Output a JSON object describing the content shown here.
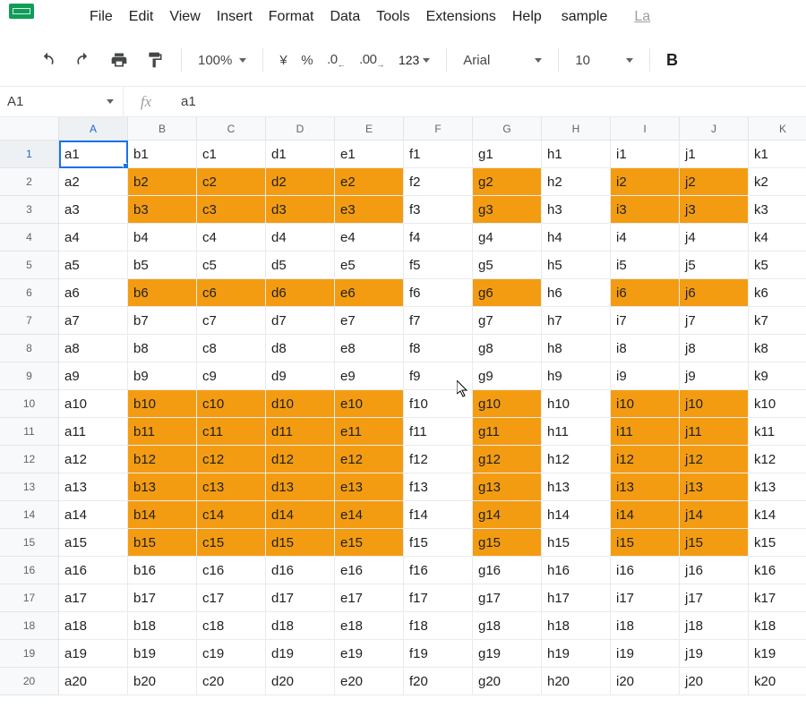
{
  "menu": {
    "items": [
      "File",
      "Edit",
      "View",
      "Insert",
      "Format",
      "Data",
      "Tools",
      "Extensions",
      "Help",
      "sample"
    ],
    "last": "La"
  },
  "toolbar": {
    "zoom": "100%",
    "currency": "¥",
    "percent": "%",
    "dec_dec": ".0",
    "inc_dec": ".00",
    "num_fmt": "123",
    "font": "Arial",
    "font_size": "10"
  },
  "name_box": "A1",
  "formula": "a1",
  "columns": [
    "A",
    "B",
    "C",
    "D",
    "E",
    "F",
    "G",
    "H",
    "I",
    "J",
    "K"
  ],
  "rows": [
    1,
    2,
    3,
    4,
    5,
    6,
    7,
    8,
    9,
    10,
    11,
    12,
    13,
    14,
    15,
    16,
    17,
    18,
    19,
    20
  ],
  "active": {
    "col": 0,
    "row": 0
  },
  "highlight": {
    "rows": [
      2,
      3,
      6,
      10,
      11,
      12,
      13,
      14,
      15
    ],
    "cols": [
      "B",
      "C",
      "D",
      "E",
      "G",
      "I",
      "J"
    ]
  },
  "col_letters": [
    "a",
    "b",
    "c",
    "d",
    "e",
    "f",
    "g",
    "h",
    "i",
    "j",
    "k"
  ]
}
